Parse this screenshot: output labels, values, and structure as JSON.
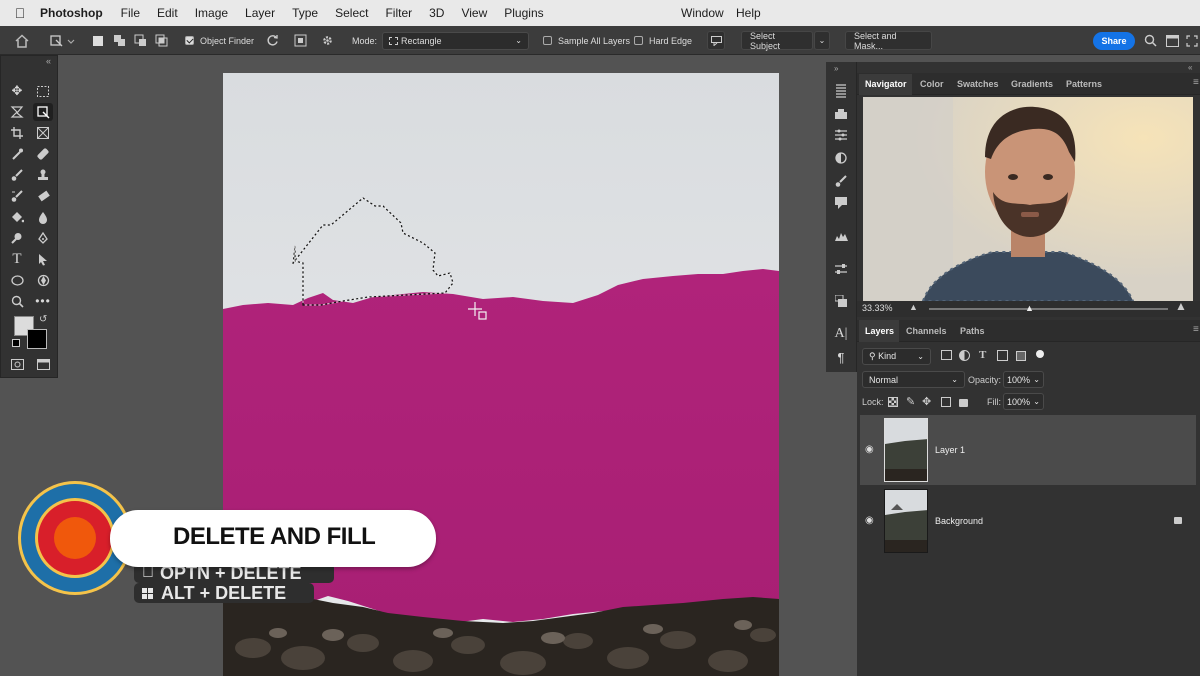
{
  "menubar": {
    "app_name": "Photoshop",
    "items": [
      "File",
      "Edit",
      "Image",
      "Layer",
      "Type",
      "Select",
      "Filter",
      "3D",
      "View",
      "Plugins"
    ],
    "window_label": "Window",
    "help_label": "Help"
  },
  "options": {
    "object_finder_label": "Object Finder",
    "mode_label": "Mode:",
    "mode_value": "Rectangle",
    "sample_all_layers_label": "Sample All Layers",
    "hard_edge_label": "Hard Edge",
    "select_subject_label": "Select Subject",
    "select_and_mask_label": "Select and Mask...",
    "share_label": "Share"
  },
  "panel_tabs": [
    "Navigator",
    "Color",
    "Swatches",
    "Gradients",
    "Patterns"
  ],
  "navigator": {
    "zoom": "33.33%"
  },
  "layers_tabs": [
    "Layers",
    "Channels",
    "Paths"
  ],
  "layers": {
    "kind_label": "Kind",
    "blend_mode": "Normal",
    "opacity_label": "Opacity:",
    "opacity_value": "100%",
    "lock_label": "Lock:",
    "fill_label": "Fill:",
    "fill_value": "100%",
    "items": [
      {
        "name": "Layer 1"
      },
      {
        "name": "Background"
      }
    ]
  },
  "overlay": {
    "title": "DELETE AND FILL",
    "shortcut_mac": "OPTN + DELETE",
    "shortcut_win": "ALT + DELETE"
  },
  "colors": {
    "magenta_fill": "#ad2278",
    "accent_blue": "#1473e6",
    "logo_blue": "#1e6fa8",
    "logo_red": "#d81f2a",
    "logo_orange": "#f0580c"
  }
}
